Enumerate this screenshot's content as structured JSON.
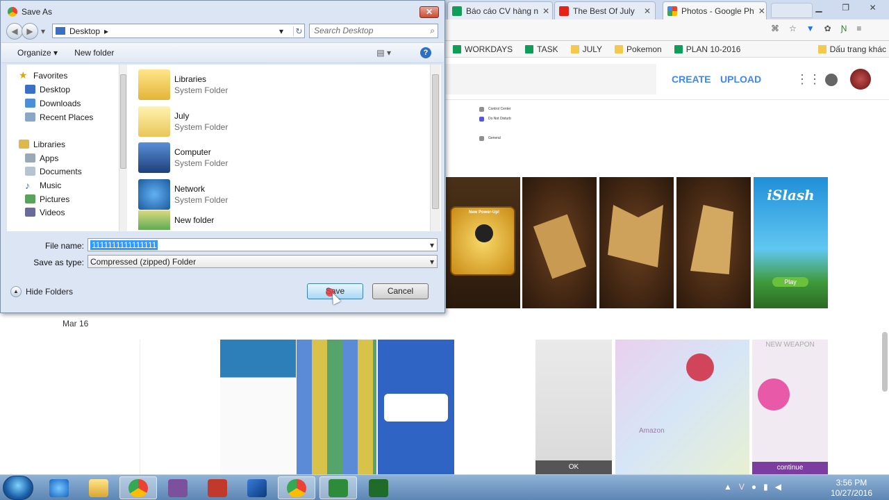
{
  "browser": {
    "tabs": [
      {
        "label": "Báo cáo CV hàng n",
        "icon": "sheets-icon"
      },
      {
        "label": "The Best Of July",
        "icon": "youtube-icon"
      },
      {
        "label": "Photos - Google Ph",
        "icon": "google-photos-icon"
      }
    ],
    "bookmarks": [
      "WORKDAYS",
      "TASK",
      "JULY",
      "Pokemon",
      "PLAN 10-2016"
    ],
    "other_bookmarks": "Dấu trang khác"
  },
  "photos": {
    "create_label": "CREATE",
    "upload_label": "UPLOAD",
    "settings_rows": [
      "Control Center",
      "Do Not Disturb",
      "General"
    ],
    "section_date": "Mar 16",
    "game_title": "iSlash",
    "powerup_label": "New Power-Up!",
    "play_label": "Play",
    "continue_label": "continue",
    "new_weapon_label": "NEW WEAPON",
    "ok_label": "OK",
    "amazon_label": "Amazon"
  },
  "dialog": {
    "title": "Save As",
    "close": "✕",
    "address": "Desktop",
    "search_placeholder": "Search Desktop",
    "organize_label": "Organize",
    "new_folder_label": "New folder",
    "nav": {
      "favorites_header": "Favorites",
      "favorites": [
        "Desktop",
        "Downloads",
        "Recent Places"
      ],
      "libraries_header": "Libraries",
      "libraries": [
        "Apps",
        "Documents",
        "Music",
        "Pictures",
        "Videos"
      ]
    },
    "files": [
      {
        "name": "Libraries",
        "type": "System Folder"
      },
      {
        "name": "July",
        "type": "System Folder"
      },
      {
        "name": "Computer",
        "type": "System Folder"
      },
      {
        "name": "Network",
        "type": "System Folder"
      },
      {
        "name": "New folder",
        "type": ""
      }
    ],
    "file_name_label": "File name:",
    "file_name_value": "1111111111111111",
    "save_type_label": "Save as type:",
    "save_type_value": "Compressed (zipped) Folder",
    "hide_folders_label": "Hide Folders",
    "save_label": "Save",
    "cancel_label": "Cancel"
  },
  "taskbar": {
    "time": "3:56 PM",
    "date": "10/27/2016"
  }
}
